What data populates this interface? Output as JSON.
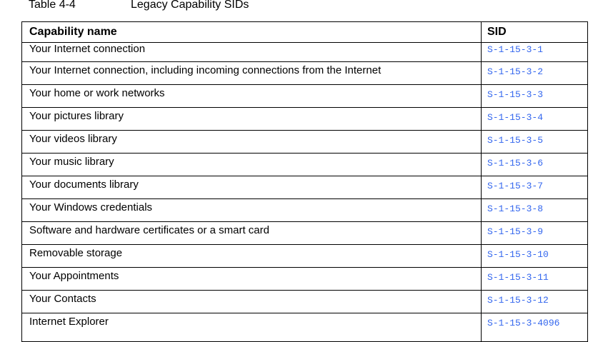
{
  "caption": {
    "number": "Table 4-4",
    "title": "Legacy Capability SIDs"
  },
  "table": {
    "headers": [
      "Capability name",
      "SID"
    ],
    "rows": [
      {
        "name": "Your Internet connection",
        "sid": "S-1-15-3-1"
      },
      {
        "name": "Your Internet connection, including incoming connections from the Internet",
        "sid": "S-1-15-3-2"
      },
      {
        "name": "Your home or work networks",
        "sid": "S-1-15-3-3"
      },
      {
        "name": "Your pictures library",
        "sid": "S-1-15-3-4"
      },
      {
        "name": "Your videos library",
        "sid": "S-1-15-3-5"
      },
      {
        "name": "Your music library",
        "sid": "S-1-15-3-6"
      },
      {
        "name": "Your documents library",
        "sid": "S-1-15-3-7"
      },
      {
        "name": "Your Windows credentials",
        "sid": "S-1-15-3-8"
      },
      {
        "name": "Software and hardware certificates or a smart card",
        "sid": "S-1-15-3-9"
      },
      {
        "name": "Removable storage",
        "sid": "S-1-15-3-10"
      },
      {
        "name": "Your Appointments",
        "sid": "S-1-15-3-11"
      },
      {
        "name": "Your Contacts",
        "sid": "S-1-15-3-12"
      },
      {
        "name": "Internet Explorer",
        "sid": "S-1-15-3-4096"
      }
    ]
  },
  "colors": {
    "sid_text": "#3366ee",
    "text": "#000000",
    "border": "#000000"
  }
}
